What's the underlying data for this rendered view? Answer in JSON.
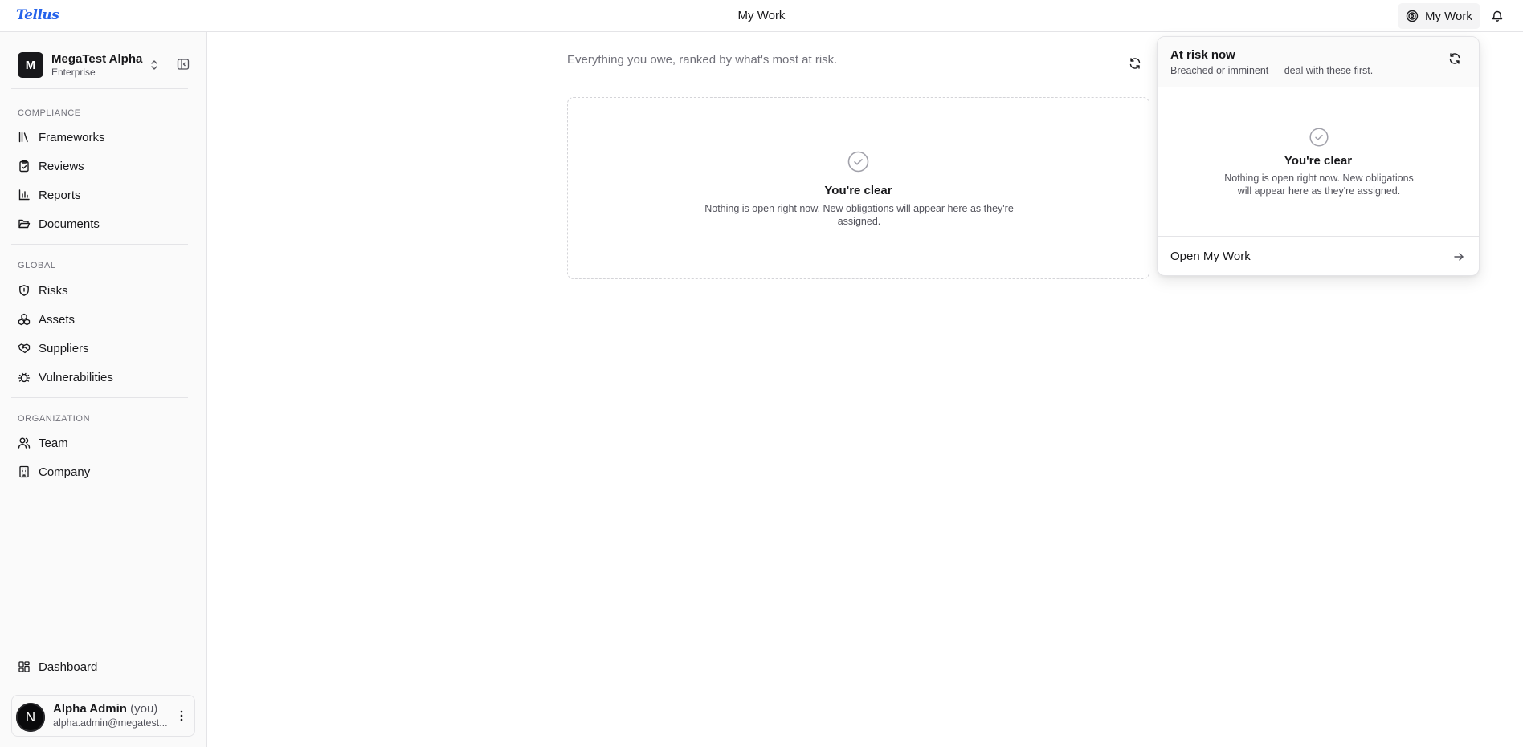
{
  "app": {
    "logo": "Tellus",
    "page_title": "My Work"
  },
  "topbar": {
    "my_work_label": "My Work",
    "icons": [
      "target-icon",
      "bell-icon"
    ]
  },
  "sidebar": {
    "org": {
      "initial": "M",
      "name": "MegaTest Alpha",
      "plan": "Enterprise"
    },
    "sections": [
      {
        "label": "COMPLIANCE",
        "items": [
          {
            "label": "Frameworks",
            "icon": "library-icon"
          },
          {
            "label": "Reviews",
            "icon": "clipboard-check-icon"
          },
          {
            "label": "Reports",
            "icon": "bar-chart-icon"
          },
          {
            "label": "Documents",
            "icon": "folder-open-icon"
          }
        ]
      },
      {
        "label": "GLOBAL",
        "items": [
          {
            "label": "Risks",
            "icon": "shield-icon"
          },
          {
            "label": "Assets",
            "icon": "boxes-icon"
          },
          {
            "label": "Suppliers",
            "icon": "handshake-icon"
          },
          {
            "label": "Vulnerabilities",
            "icon": "bug-icon"
          }
        ]
      },
      {
        "label": "ORGANIZATION",
        "items": [
          {
            "label": "Team",
            "icon": "users-icon"
          },
          {
            "label": "Company",
            "icon": "building-icon"
          }
        ]
      }
    ],
    "dashboard_label": "Dashboard",
    "user": {
      "avatar_letter": "N",
      "name": "Alpha Admin",
      "you": "(you)",
      "email": "alpha.admin@megatest..."
    }
  },
  "main": {
    "subtitle": "Everything you owe, ranked by what's most at risk.",
    "empty": {
      "title": "You're clear",
      "description": "Nothing is open right now. New obligations will appear here as they're assigned."
    }
  },
  "popover": {
    "title": "At risk now",
    "subtitle": "Breached or imminent — deal with these first.",
    "empty_title": "You're clear",
    "empty_description": "Nothing is open right now. New obligations will appear here as they're assigned.",
    "footer_label": "Open My Work"
  },
  "colors": {
    "brand": "#2563eb",
    "text": "#18181b",
    "muted": "#71717a",
    "border": "#e4e4e7"
  }
}
